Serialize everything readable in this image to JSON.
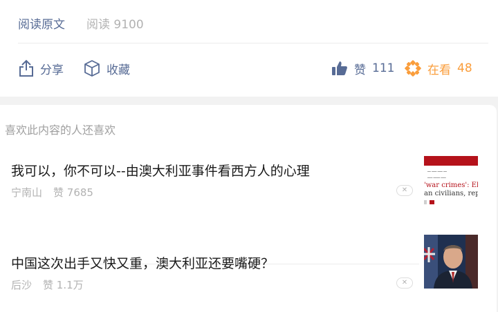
{
  "footer": {
    "read_original": "阅读原文",
    "read_count": "阅读 9100"
  },
  "actions": {
    "share": {
      "label": "分享",
      "icon": "share-icon"
    },
    "collect": {
      "label": "收藏",
      "icon": "box-icon"
    },
    "like": {
      "label": "赞",
      "count": "111",
      "icon": "thumbs-up-icon"
    },
    "wow": {
      "label": "在看",
      "count": "48",
      "icon": "wow-flower-icon"
    }
  },
  "colors": {
    "link": "#576b95",
    "wow": "#fa9d3b",
    "muted": "#b2b2b2"
  },
  "recommend": {
    "title": "喜欢此内容的人还喜欢",
    "items": [
      {
        "title": "我可以，你不可以--由澳大利亚事件看西方人的心理",
        "source": "宁南山",
        "likes": "赞 7685",
        "thumb_lines": [
          "'war crimes': Elite",
          "an civilians, repor"
        ]
      },
      {
        "title": "中国这次出手又快又重，澳大利亚还要嘴硬？",
        "source": "后沙",
        "likes": "赞 1.1万"
      }
    ]
  }
}
